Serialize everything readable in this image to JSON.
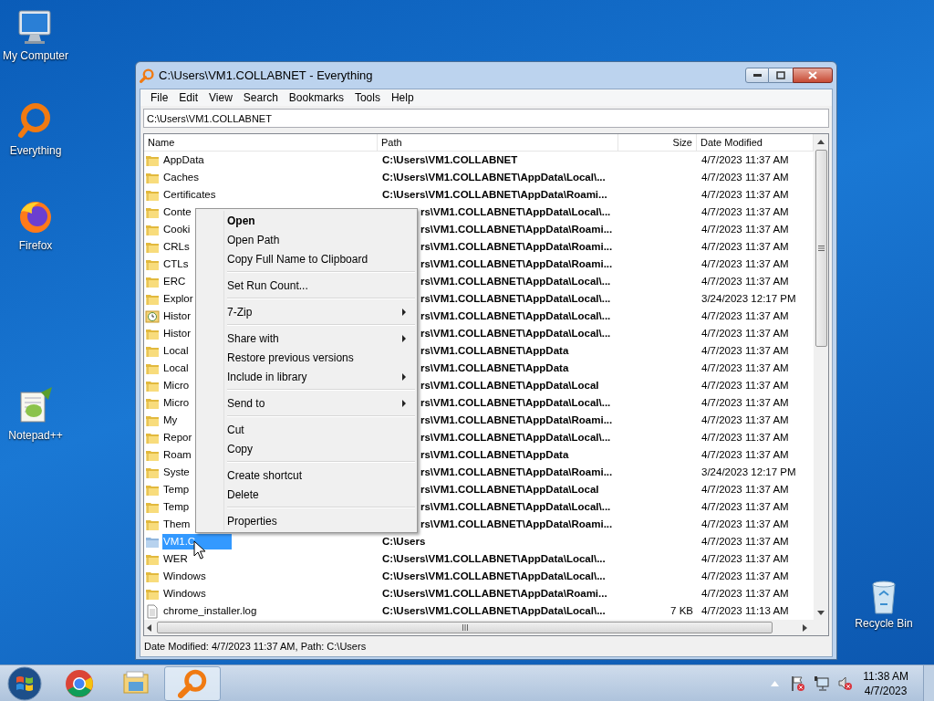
{
  "desktop_icons": [
    {
      "label": "My Computer",
      "kind": "computer"
    },
    {
      "label": "Everything",
      "kind": "everything"
    },
    {
      "label": "Firefox",
      "kind": "firefox"
    },
    {
      "label": "Notepad++",
      "kind": "notepad"
    },
    {
      "label": "Recycle Bin",
      "kind": "recycle"
    }
  ],
  "window": {
    "title": "C:\\Users\\VM1.COLLABNET - Everything"
  },
  "menu_bar": [
    "File",
    "Edit",
    "View",
    "Search",
    "Bookmarks",
    "Tools",
    "Help"
  ],
  "search": {
    "value": "C:\\Users\\VM1.COLLABNET"
  },
  "table": {
    "columns": [
      "Name",
      "Path",
      "Size",
      "Date Modified"
    ],
    "rows": [
      {
        "kind": "folder",
        "name": "AppData",
        "path": "C:\\Users\\VM1.COLLABNET",
        "size": "",
        "date": "4/7/2023 11:37 AM",
        "selected": false
      },
      {
        "kind": "folder",
        "name": "Caches",
        "path": "C:\\Users\\VM1.COLLABNET\\AppData\\Local\\...",
        "size": "",
        "date": "4/7/2023 11:37 AM",
        "selected": false
      },
      {
        "kind": "folder",
        "name": "Certificates",
        "path": "C:\\Users\\VM1.COLLABNET\\AppData\\Roami...",
        "size": "",
        "date": "4/7/2023 11:37 AM",
        "selected": false
      },
      {
        "kind": "folder",
        "name": "Conte",
        "path": "rs\\VM1.COLLABNET\\AppData\\Local\\...",
        "size": "",
        "date": "4/7/2023 11:37 AM",
        "selected": false
      },
      {
        "kind": "folder",
        "name": "Cooki",
        "path": "rs\\VM1.COLLABNET\\AppData\\Roami...",
        "size": "",
        "date": "4/7/2023 11:37 AM",
        "selected": false
      },
      {
        "kind": "folder",
        "name": "CRLs",
        "path": "rs\\VM1.COLLABNET\\AppData\\Roami...",
        "size": "",
        "date": "4/7/2023 11:37 AM",
        "selected": false
      },
      {
        "kind": "folder",
        "name": "CTLs",
        "path": "rs\\VM1.COLLABNET\\AppData\\Roami...",
        "size": "",
        "date": "4/7/2023 11:37 AM",
        "selected": false
      },
      {
        "kind": "folder",
        "name": "ERC",
        "path": "rs\\VM1.COLLABNET\\AppData\\Local\\...",
        "size": "",
        "date": "4/7/2023 11:37 AM",
        "selected": false
      },
      {
        "kind": "folder",
        "name": "Explor",
        "path": "rs\\VM1.COLLABNET\\AppData\\Local\\...",
        "size": "",
        "date": "3/24/2023 12:17 PM",
        "selected": false
      },
      {
        "kind": "history",
        "name": "Histor",
        "path": "rs\\VM1.COLLABNET\\AppData\\Local\\...",
        "size": "",
        "date": "4/7/2023 11:37 AM",
        "selected": false
      },
      {
        "kind": "folder",
        "name": "Histor",
        "path": "rs\\VM1.COLLABNET\\AppData\\Local\\...",
        "size": "",
        "date": "4/7/2023 11:37 AM",
        "selected": false
      },
      {
        "kind": "folder",
        "name": "Local",
        "path": "rs\\VM1.COLLABNET\\AppData",
        "size": "",
        "date": "4/7/2023 11:37 AM",
        "selected": false
      },
      {
        "kind": "folder",
        "name": "Local",
        "path": "rs\\VM1.COLLABNET\\AppData",
        "size": "",
        "date": "4/7/2023 11:37 AM",
        "selected": false
      },
      {
        "kind": "folder",
        "name": "Micro",
        "path": "rs\\VM1.COLLABNET\\AppData\\Local",
        "size": "",
        "date": "4/7/2023 11:37 AM",
        "selected": false
      },
      {
        "kind": "folder",
        "name": "Micro",
        "path": "rs\\VM1.COLLABNET\\AppData\\Local\\...",
        "size": "",
        "date": "4/7/2023 11:37 AM",
        "selected": false
      },
      {
        "kind": "folder",
        "name": "My",
        "path": "rs\\VM1.COLLABNET\\AppData\\Roami...",
        "size": "",
        "date": "4/7/2023 11:37 AM",
        "selected": false
      },
      {
        "kind": "folder",
        "name": "Repor",
        "path": "rs\\VM1.COLLABNET\\AppData\\Local\\...",
        "size": "",
        "date": "4/7/2023 11:37 AM",
        "selected": false
      },
      {
        "kind": "folder",
        "name": "Roam",
        "path": "rs\\VM1.COLLABNET\\AppData",
        "size": "",
        "date": "4/7/2023 11:37 AM",
        "selected": false
      },
      {
        "kind": "folder",
        "name": "Syste",
        "path": "rs\\VM1.COLLABNET\\AppData\\Roami...",
        "size": "",
        "date": "3/24/2023 12:17 PM",
        "selected": false
      },
      {
        "kind": "folder",
        "name": "Temp",
        "path": "rs\\VM1.COLLABNET\\AppData\\Local",
        "size": "",
        "date": "4/7/2023 11:37 AM",
        "selected": false
      },
      {
        "kind": "folder",
        "name": "Temp",
        "path": "rs\\VM1.COLLABNET\\AppData\\Local\\...",
        "size": "",
        "date": "4/7/2023 11:37 AM",
        "selected": false
      },
      {
        "kind": "folder",
        "name": "Them",
        "path": "rs\\VM1.COLLABNET\\AppData\\Roami...",
        "size": "",
        "date": "4/7/2023 11:37 AM",
        "selected": false
      },
      {
        "kind": "user",
        "name": "VM1.C",
        "path": "C:\\Users",
        "size": "",
        "date": "4/7/2023 11:37 AM",
        "selected": true
      },
      {
        "kind": "folder",
        "name": "WER",
        "path": "C:\\Users\\VM1.COLLABNET\\AppData\\Local\\...",
        "size": "",
        "date": "4/7/2023 11:37 AM",
        "selected": false
      },
      {
        "kind": "folder",
        "name": "Windows",
        "path": "C:\\Users\\VM1.COLLABNET\\AppData\\Local\\...",
        "size": "",
        "date": "4/7/2023 11:37 AM",
        "selected": false
      },
      {
        "kind": "folder",
        "name": "Windows",
        "path": "C:\\Users\\VM1.COLLABNET\\AppData\\Roami...",
        "size": "",
        "date": "4/7/2023 11:37 AM",
        "selected": false
      },
      {
        "kind": "file",
        "name": "chrome_installer.log",
        "path": "C:\\Users\\VM1.COLLABNET\\AppData\\Local\\...",
        "size": "7 KB",
        "date": "4/7/2023 11:13 AM",
        "selected": false
      }
    ]
  },
  "context_menu": [
    [
      {
        "label": "Open",
        "default": true,
        "submenu": false
      },
      {
        "label": "Open Path",
        "default": false,
        "submenu": false
      },
      {
        "label": "Copy Full Name to Clipboard",
        "default": false,
        "submenu": false
      }
    ],
    [
      {
        "label": "Set Run Count...",
        "default": false,
        "submenu": false
      }
    ],
    [
      {
        "label": "7-Zip",
        "default": false,
        "submenu": true
      }
    ],
    [
      {
        "label": "Share with",
        "default": false,
        "submenu": true
      },
      {
        "label": "Restore previous versions",
        "default": false,
        "submenu": false
      },
      {
        "label": "Include in library",
        "default": false,
        "submenu": true
      }
    ],
    [
      {
        "label": "Send to",
        "default": false,
        "submenu": true
      }
    ],
    [
      {
        "label": "Cut",
        "default": false,
        "submenu": false
      },
      {
        "label": "Copy",
        "default": false,
        "submenu": false
      }
    ],
    [
      {
        "label": "Create shortcut",
        "default": false,
        "submenu": false
      },
      {
        "label": "Delete",
        "default": false,
        "submenu": false
      }
    ],
    [
      {
        "label": "Properties",
        "default": false,
        "submenu": false
      }
    ]
  ],
  "status_bar": "Date Modified: 4/7/2023 11:37 AM, Path: C:\\Users",
  "taskbar": {
    "apps": [
      {
        "kind": "chrome",
        "active": false
      },
      {
        "kind": "explorer",
        "active": false
      },
      {
        "kind": "everything",
        "active": true
      }
    ],
    "clock": {
      "time": "11:38 AM",
      "date": "4/7/2023"
    }
  }
}
